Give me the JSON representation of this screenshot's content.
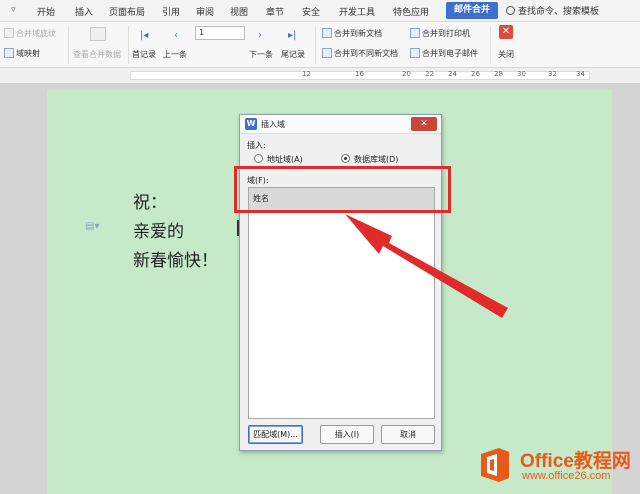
{
  "menubar": {
    "items": [
      "开始",
      "插入",
      "页面布局",
      "引用",
      "审阅",
      "视图",
      "章节",
      "安全",
      "开发工具",
      "特色应用"
    ],
    "active_tab": "邮件合并",
    "search": "查找命令、搜索模板"
  },
  "ribbon": {
    "merge_fields": "合并域底纹",
    "field_map": "域映射",
    "view_merged": "查看合并数据",
    "first": "首记录",
    "prev": "上一条",
    "record_no": "1",
    "next": "下一条",
    "last": "尾记录",
    "to_new_doc": "合并到新文档",
    "to_diff_docs": "合并到不同新文档",
    "to_printer": "合并到打印机",
    "to_email": "合并到电子邮件",
    "close": "关闭"
  },
  "ruler": {
    "numbers": [
      "12",
      "16",
      "20",
      "22",
      "24",
      "26",
      "28",
      "30",
      "32",
      "34"
    ]
  },
  "document": {
    "lines": [
      "祝：",
      "亲爱的",
      "新春愉快！"
    ]
  },
  "dialog": {
    "title": "插入域",
    "insert_label": "插入:",
    "radio_address": "地址域(A)",
    "radio_database": "数据库域(D)",
    "field_label": "域(F):",
    "fields": [
      "姓名"
    ],
    "btn_match": "匹配域(M)...",
    "btn_insert": "插入(I)",
    "btn_cancel": "取消",
    "close": "✕"
  },
  "logo": {
    "brand": "Office教程网",
    "site": "www.office26.com",
    "colors": {
      "orange": "#e85a1a"
    }
  }
}
